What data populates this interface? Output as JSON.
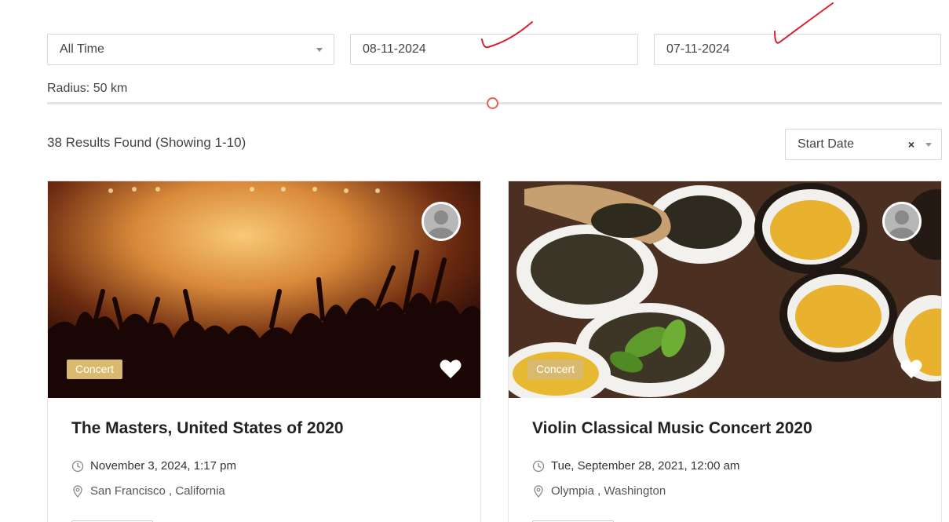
{
  "filters": {
    "time_select": "All Time",
    "start_date": "08-11-2024",
    "end_date": "07-11-2024"
  },
  "radius": {
    "label": "Radius: 50 km",
    "value_km": 50
  },
  "results": {
    "summary": "38 Results Found (Showing 1-10)"
  },
  "sort": {
    "selected": "Start Date",
    "clear_glyph": "×"
  },
  "cards": [
    {
      "badge": "Concert",
      "title": "The Masters, United States of 2020",
      "date": "November 3, 2024, 1:17 pm",
      "location": "San Francisco , California",
      "image": "concert-crowd-image"
    },
    {
      "badge": "Concert",
      "title": "Violin Classical Music Concert 2020",
      "date": "Tue, September 28, 2021, 12:00 am",
      "location": "Olympia , Washington",
      "image": "tea-bowls-image"
    }
  ],
  "colors": {
    "badge": "#d9b96f",
    "slider_handle": "#e0634f",
    "annotation_marks": "#d9202c"
  }
}
